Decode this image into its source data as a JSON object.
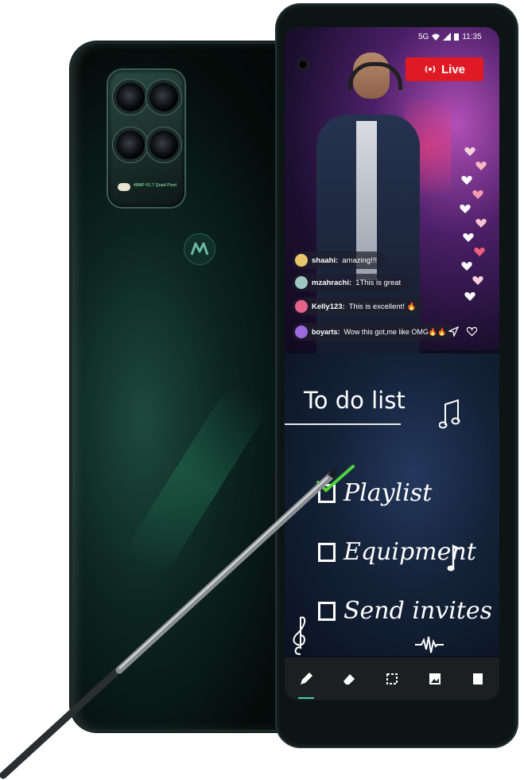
{
  "status_bar": {
    "network": "5G",
    "time": "11:35"
  },
  "live_badge": {
    "label": "Live"
  },
  "chat": [
    {
      "user": "shaahi:",
      "message": "amazing!!!",
      "avatar_color": "#e8c46b"
    },
    {
      "user": "mzahrachi:",
      "message": "1This is great",
      "avatar_color": "#9ec7c2"
    },
    {
      "user": "Kelly123:",
      "message": "This is excellent! 🔥",
      "avatar_color": "#e7628b"
    },
    {
      "user": "boyarts:",
      "message": "Wow this got,me like OMG🔥🔥",
      "avatar_color": "#9c6be0"
    }
  ],
  "notes": {
    "title": "To do list",
    "items": [
      {
        "label": "Playlist",
        "checked": true
      },
      {
        "label": "Equipment",
        "checked": false
      },
      {
        "label": "Send invites",
        "checked": false
      }
    ],
    "check_color": "#4fd33a"
  },
  "toolbar": {
    "tools": [
      "pen-icon",
      "eraser-icon",
      "crop-icon",
      "image-icon",
      "page-icon"
    ],
    "active_tool": "pen-icon",
    "accent": "#3fd0b0"
  },
  "back_phone": {
    "camera_label": "48MP f/1.7 Quad Pixel"
  }
}
